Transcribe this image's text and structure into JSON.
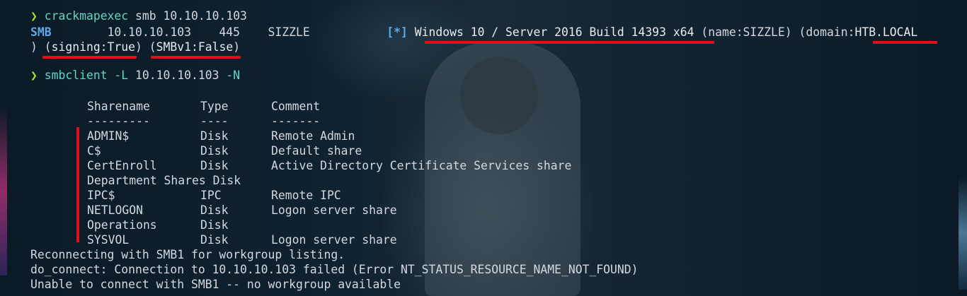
{
  "terminal": {
    "prompt_symbol": "❯",
    "cmd1": {
      "program": "crackmapexec",
      "args": " smb 10.10.10.103"
    },
    "smb_result": {
      "tag": "SMB",
      "ip_port_host": "        10.10.10.103    445    SIZZLE           ",
      "marker": "[*]",
      "os": " Windows 10 / Server 2016 Build 14393 x64",
      "name": " (name:SIZZLE)",
      "domain_prefix": " (domain:",
      "domain": "HTB.LOCAL",
      "wrap_prefix": ") (",
      "signing": "signing:True",
      "mid": ") (",
      "smbv1": "SMBv1:False",
      "wrap_suffix": ")"
    },
    "cmd2": {
      "program": "smbclient",
      "flag_l": " -L",
      "ip": " 10.10.10.103",
      "flag_n": " -N"
    },
    "shares_header": {
      "col1": "Sharename",
      "col2": "Type",
      "col3": "Comment",
      "sep1": "---------",
      "sep2": "----",
      "sep3": "-------"
    },
    "shares": [
      {
        "name": "ADMIN$",
        "type": "Disk",
        "comment": "Remote Admin"
      },
      {
        "name": "C$",
        "type": "Disk",
        "comment": "Default share"
      },
      {
        "name": "CertEnroll",
        "type": "Disk",
        "comment": "Active Directory Certificate Services share"
      },
      {
        "name": "Department Shares Disk",
        "type": "",
        "comment": ""
      },
      {
        "name": "IPC$",
        "type": "IPC",
        "comment": "Remote IPC"
      },
      {
        "name": "NETLOGON",
        "type": "Disk",
        "comment": "Logon server share"
      },
      {
        "name": "Operations",
        "type": "Disk",
        "comment": ""
      },
      {
        "name": "SYSVOL",
        "type": "Disk",
        "comment": "Logon server share"
      }
    ],
    "footer": [
      "Reconnecting with SMB1 for workgroup listing.",
      "do_connect: Connection to 10.10.10.103 failed (Error NT_STATUS_RESOURCE_NAME_NOT_FOUND)",
      "Unable to connect with SMB1 -- no workgroup available"
    ]
  },
  "colors": {
    "annotation_red": "#e0101a",
    "prompt_green": "#a6e22e",
    "command_teal": "#5fd7c8",
    "smb_blue": "#5fa8e8"
  }
}
